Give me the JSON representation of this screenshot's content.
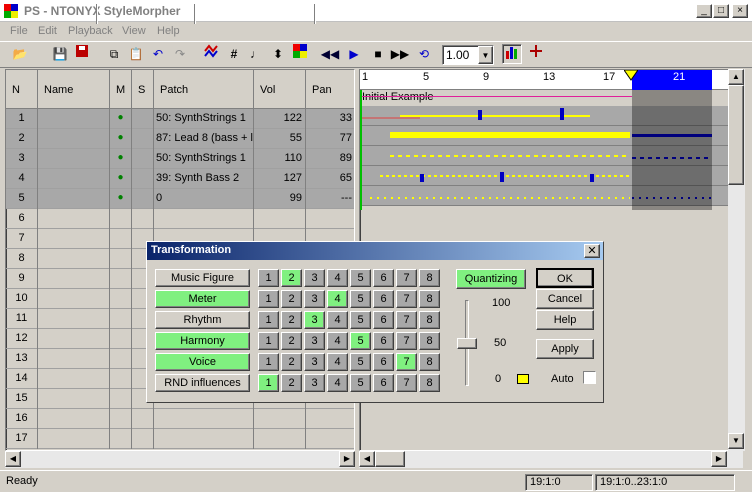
{
  "window": {
    "title": "PS - NTONYX StyleMorpher",
    "min": "_",
    "max": "□",
    "close": "×"
  },
  "menu": [
    "File",
    "Edit",
    "Playback",
    "View",
    "Help"
  ],
  "toolbar": {
    "tempo": "1.00"
  },
  "grid": {
    "headers": {
      "n": "N",
      "name": "Name",
      "m": "M",
      "s": "S",
      "patch": "Patch",
      "vol": "Vol",
      "pan": "Pan"
    },
    "rows": [
      {
        "n": "1",
        "m": "●",
        "patch": "50: SynthStrings 1",
        "vol": "122",
        "pan": "33"
      },
      {
        "n": "2",
        "m": "●",
        "patch": "87: Lead 8 (bass + l",
        "vol": "55",
        "pan": "77"
      },
      {
        "n": "3",
        "m": "●",
        "patch": "50: SynthStrings 1",
        "vol": "110",
        "pan": "89"
      },
      {
        "n": "4",
        "m": "●",
        "patch": "39: Synth Bass 2",
        "vol": "127",
        "pan": "65"
      },
      {
        "n": "5",
        "m": "●",
        "patch": "0",
        "vol": "99",
        "pan": "---"
      },
      {
        "n": "6"
      },
      {
        "n": "7"
      },
      {
        "n": "8"
      },
      {
        "n": "9"
      },
      {
        "n": "10"
      },
      {
        "n": "11"
      },
      {
        "n": "12"
      },
      {
        "n": "13"
      },
      {
        "n": "14"
      },
      {
        "n": "15"
      },
      {
        "n": "16"
      },
      {
        "n": "17"
      }
    ]
  },
  "ruler": {
    "marks": [
      "1",
      "5",
      "9",
      "13",
      "17",
      "21"
    ]
  },
  "sequence": {
    "name": "Initial Example"
  },
  "dialog": {
    "title": "Transformation",
    "categories": [
      {
        "label": "Music Figure",
        "active": false,
        "selected": 2
      },
      {
        "label": "Meter",
        "active": true,
        "selected": 4
      },
      {
        "label": "Rhythm",
        "active": false,
        "selected": 3
      },
      {
        "label": "Harmony",
        "active": true,
        "selected": 5
      },
      {
        "label": "Voice",
        "active": true,
        "selected": 7
      },
      {
        "label": "RND influences",
        "active": false,
        "selected": 1
      }
    ],
    "numbers": [
      "1",
      "2",
      "3",
      "4",
      "5",
      "6",
      "7",
      "8"
    ],
    "quantizing": "Quantizing",
    "slider": {
      "max": "100",
      "mid": "50",
      "min": "0",
      "value": 0.5
    },
    "ok": "OK",
    "cancel": "Cancel",
    "help": "Help",
    "apply": "Apply",
    "auto": "Auto"
  },
  "status": {
    "left": "Ready",
    "pos": "19:1:0",
    "range": "19:1:0..23:1:0"
  }
}
